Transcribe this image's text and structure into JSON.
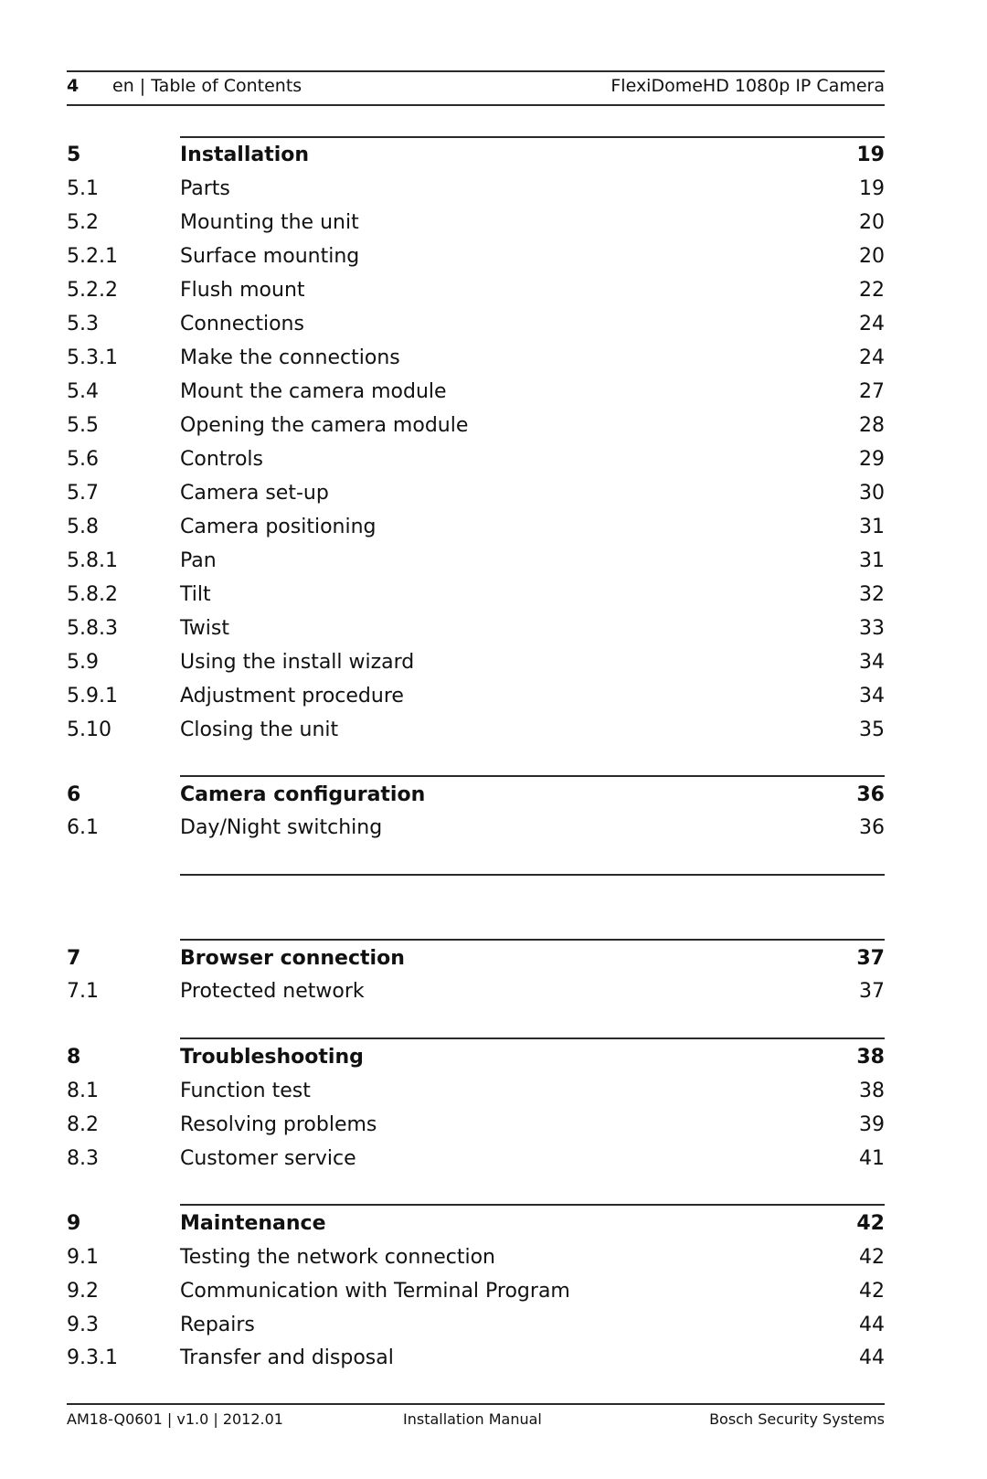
{
  "header": {
    "page_number": "4",
    "section_label": "en | Table of Contents",
    "document_title": "FlexiDomeHD 1080p IP Camera"
  },
  "toc": [
    {
      "num": "5",
      "title": "Installation",
      "page": "19",
      "level": "chapter"
    },
    {
      "num": "5.1",
      "title": "Parts",
      "page": "19",
      "level": "entry"
    },
    {
      "num": "5.2",
      "title": "Mounting the unit",
      "page": "20",
      "level": "entry"
    },
    {
      "num": "5.2.1",
      "title": "Surface mounting",
      "page": "20",
      "level": "entry"
    },
    {
      "num": "5.2.2",
      "title": "Flush mount",
      "page": "22",
      "level": "entry"
    },
    {
      "num": "5.3",
      "title": "Connections",
      "page": "24",
      "level": "entry"
    },
    {
      "num": "5.3.1",
      "title": "Make the connections",
      "page": "24",
      "level": "entry"
    },
    {
      "num": "5.4",
      "title": "Mount the camera module",
      "page": "27",
      "level": "entry"
    },
    {
      "num": "5.5",
      "title": "Opening the camera module",
      "page": "28",
      "level": "entry"
    },
    {
      "num": "5.6",
      "title": "Controls",
      "page": "29",
      "level": "entry"
    },
    {
      "num": "5.7",
      "title": "Camera set-up",
      "page": "30",
      "level": "entry"
    },
    {
      "num": "5.8",
      "title": "Camera positioning",
      "page": "31",
      "level": "entry"
    },
    {
      "num": "5.8.1",
      "title": "Pan",
      "page": "31",
      "level": "entry"
    },
    {
      "num": "5.8.2",
      "title": "Tilt",
      "page": "32",
      "level": "entry"
    },
    {
      "num": "5.8.3",
      "title": "Twist",
      "page": "33",
      "level": "entry"
    },
    {
      "num": "5.9",
      "title": "Using the install wizard",
      "page": "34",
      "level": "entry"
    },
    {
      "num": "5.9.1",
      "title": "Adjustment procedure",
      "page": "34",
      "level": "entry"
    },
    {
      "num": "5.10",
      "title": "Closing the unit",
      "page": "35",
      "level": "entry"
    },
    {
      "num": "6",
      "title": "Camera configuration",
      "page": "36",
      "level": "chapter"
    },
    {
      "num": "6.1",
      "title": "Day/Night switching",
      "page": "36",
      "level": "entry"
    },
    {
      "num": "7",
      "title": "Browser connection",
      "page": "37",
      "level": "chapter"
    },
    {
      "num": "7.1",
      "title": "Protected network",
      "page": "37",
      "level": "entry"
    },
    {
      "num": "8",
      "title": "Troubleshooting",
      "page": "38",
      "level": "chapter"
    },
    {
      "num": "8.1",
      "title": "Function test",
      "page": "38",
      "level": "entry"
    },
    {
      "num": "8.2",
      "title": "Resolving problems",
      "page": "39",
      "level": "entry"
    },
    {
      "num": "8.3",
      "title": "Customer service",
      "page": "41",
      "level": "entry"
    },
    {
      "num": "9",
      "title": "Maintenance",
      "page": "42",
      "level": "chapter"
    },
    {
      "num": "9.1",
      "title": "Testing the network connection",
      "page": "42",
      "level": "entry"
    },
    {
      "num": "9.2",
      "title": "Communication with Terminal Program",
      "page": "42",
      "level": "entry"
    },
    {
      "num": "9.3",
      "title": "Repairs",
      "page": "44",
      "level": "entry"
    },
    {
      "num": "9.3.1",
      "title": "Transfer and disposal",
      "page": "44",
      "level": "entry"
    }
  ],
  "footer": {
    "doc_id": "AM18-Q0601 | v1.0 | 2012.01",
    "doc_type": "Installation Manual",
    "publisher": "Bosch Security Systems"
  }
}
